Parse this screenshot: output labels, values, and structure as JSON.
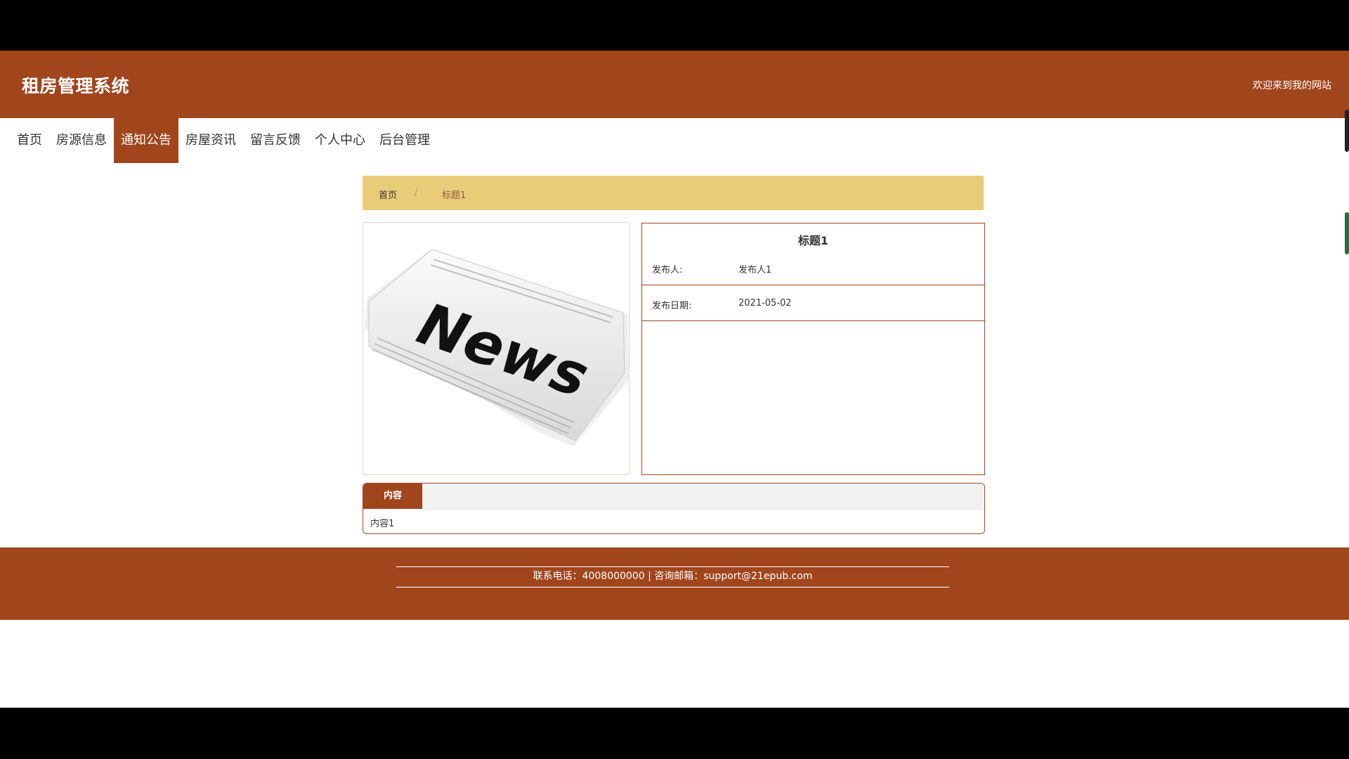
{
  "header": {
    "title": "租房管理系统",
    "welcome": "欢迎来到我的网站"
  },
  "nav": {
    "items": [
      "首页",
      "房源信息",
      "通知公告",
      "房屋资讯",
      "留言反馈",
      "个人中心",
      "后台管理"
    ],
    "active": "通知公告"
  },
  "breadcrumb": {
    "home": "首页",
    "separator": "/",
    "current": "标题1"
  },
  "image": {
    "text": "News"
  },
  "detail": {
    "title": "标题1",
    "publisher_label": "发布人:",
    "publisher_value": "发布人1",
    "date_label": "发布日期:",
    "date_value": "2021-05-02"
  },
  "content": {
    "tab_label": "内容",
    "text": "内容1"
  },
  "footer": {
    "text": "联系电话：4008000000 | 咨询邮箱：support@21epub.com"
  },
  "colors": {
    "brand": "#a1451d",
    "breadcrumb_bg": "#e9cc77"
  }
}
